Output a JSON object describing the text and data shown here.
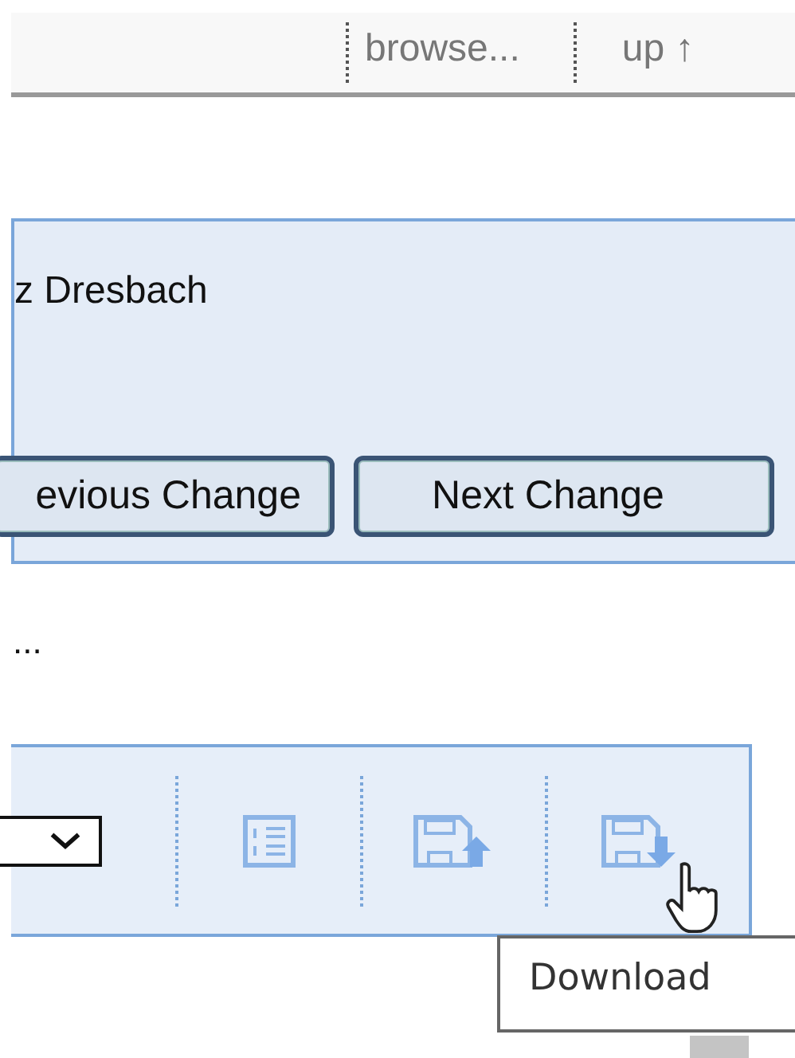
{
  "top_bar": {
    "items": [
      {
        "label": "browse..."
      },
      {
        "label": "up ↑"
      }
    ]
  },
  "author_panel": {
    "name": "z Dresbach"
  },
  "buttons": [
    {
      "label": "evious Change"
    },
    {
      "label": "Next Change"
    }
  ],
  "ellipsis": "...",
  "action_bar": {
    "tools": [
      {
        "kind": "list"
      },
      {
        "kind": "upload"
      },
      {
        "kind": "download"
      }
    ]
  },
  "tooltip": "Download"
}
